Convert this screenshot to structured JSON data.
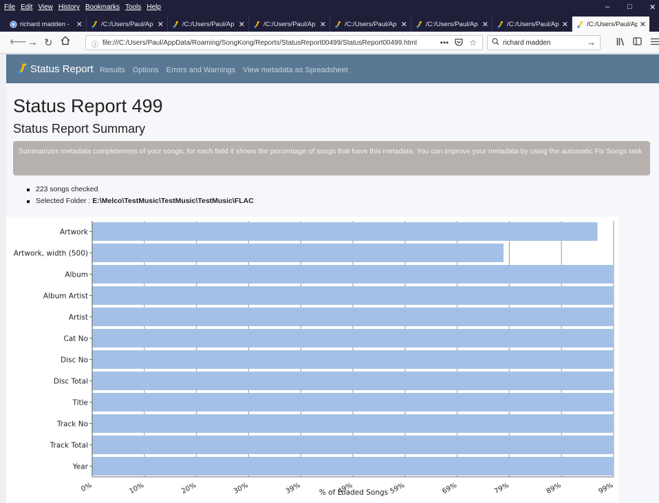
{
  "browser": {
    "menu": [
      "File",
      "Edit",
      "View",
      "History",
      "Bookmarks",
      "Tools",
      "Help"
    ],
    "window_controls": [
      "–",
      "□",
      "✕"
    ],
    "tabs": [
      {
        "title": "richard madden - ",
        "icon": "google-icon",
        "active": false
      },
      {
        "title": "/C:/Users/Paul/Ap",
        "icon": "songkong-icon",
        "active": false
      },
      {
        "title": "/C:/Users/Paul/Ap",
        "icon": "songkong-icon",
        "active": false
      },
      {
        "title": "/C:/Users/Paul/Ap",
        "icon": "songkong-icon",
        "active": false
      },
      {
        "title": "/C:/Users/Paul/Ap",
        "icon": "songkong-icon",
        "active": false
      },
      {
        "title": "/C:/Users/Paul/Ap",
        "icon": "songkong-icon",
        "active": false
      },
      {
        "title": "/C:/Users/Paul/Ap",
        "icon": "songkong-icon",
        "active": false
      },
      {
        "title": "/C:/Users/Paul/Ap",
        "icon": "songkong-icon",
        "active": true
      }
    ],
    "url": "file:///C:/Users/Paul/AppData/Roaming/SongKong/Reports/StatusReport00499/StatusReport00499.html",
    "search_value": "richard madden",
    "accent": "#5a7893"
  },
  "site_nav": {
    "brand": "Status Report",
    "links": [
      "Results",
      "Options",
      "Errors and Warnings",
      "View metadata as Spreadsheet"
    ]
  },
  "report": {
    "title": "Status Report 499",
    "subtitle": "Status Report Summary",
    "summary": "Summarizes metadata completeness of your songs, for each field it shows the percentage of songs that have this metadata. You can improve your metadata by using the automatic Fix Songs task",
    "songs_checked": "223 songs checked",
    "folder_label": "Selected Folder : ",
    "folder_path": "E:\\Melco\\TestMusic\\TestMusic\\TestMusic\\FLAC"
  },
  "chart_data": {
    "type": "bar",
    "orientation": "horizontal",
    "categories": [
      "Artwork",
      "Artwork, width (500)",
      "Album",
      "Album Artist",
      "Artist",
      "Cat No",
      "Disc No",
      "Disc Total",
      "Title",
      "Track No",
      "Track Total",
      "Year"
    ],
    "values": [
      96.9,
      78.9,
      100,
      100,
      100,
      100,
      100,
      100,
      100,
      100,
      100,
      100
    ],
    "xlabel": "% of Loaded Songs",
    "xticks": [
      "0%",
      "10%",
      "20%",
      "30%",
      "39%",
      "49%",
      "59%",
      "69%",
      "79%",
      "89%",
      "99%"
    ],
    "xlim": [
      0,
      100
    ],
    "grid": true,
    "bar_color": "#a3c1e6"
  }
}
